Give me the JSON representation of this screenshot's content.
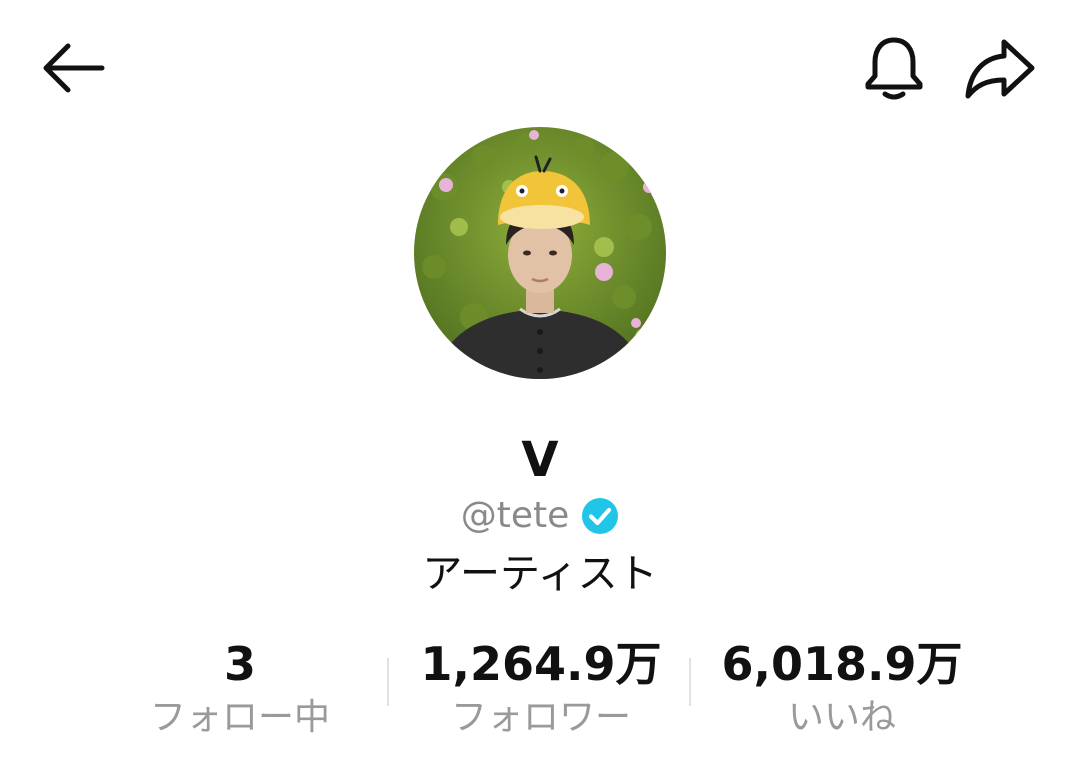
{
  "header": {
    "back_icon": "arrow-left-icon",
    "notification_icon": "bell-icon",
    "share_icon": "share-arrow-icon"
  },
  "profile": {
    "display_name": "V",
    "handle": "@tete",
    "verified": true,
    "verified_color": "#20c5e8",
    "category": "アーティスト"
  },
  "stats": [
    {
      "value": "3",
      "label": "フォロー中"
    },
    {
      "value": "1,264.9万",
      "label": "フォロワー"
    },
    {
      "value": "6,018.9万",
      "label": "いいね"
    }
  ]
}
